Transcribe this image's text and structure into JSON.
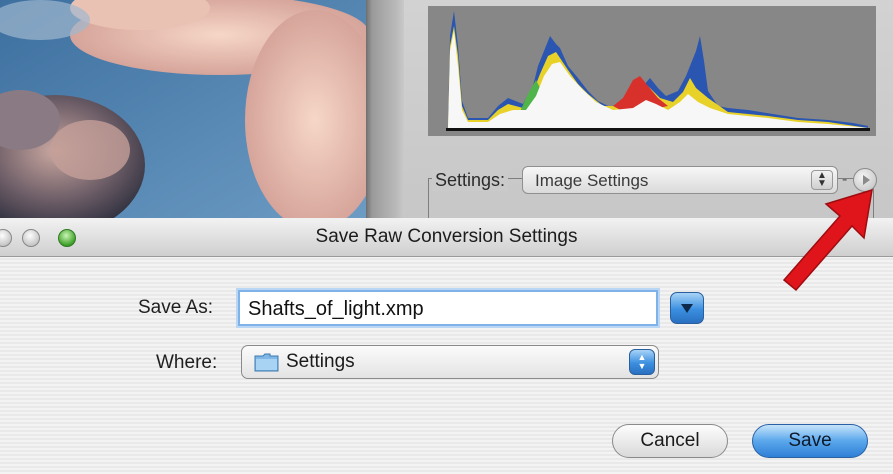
{
  "background_window": {
    "settings_label": "Settings:",
    "settings_value": "Image Settings"
  },
  "dialog": {
    "title": "Save Raw Conversion Settings",
    "save_as_label": "Save As:",
    "save_as_value": "Shafts_of_light.xmp",
    "where_label": "Where:",
    "where_value": "Settings",
    "cancel_label": "Cancel",
    "save_label": "Save"
  },
  "icons": {
    "folder": "folder-icon",
    "expand": "disclosure-triangle-icon",
    "menu": "flyout-menu-icon",
    "annotation": "red-arrow-icon"
  },
  "colors": {
    "accent_blue": "#3b8fe0",
    "annotation_red": "#e0151b",
    "histogram_bg": "#878787"
  }
}
